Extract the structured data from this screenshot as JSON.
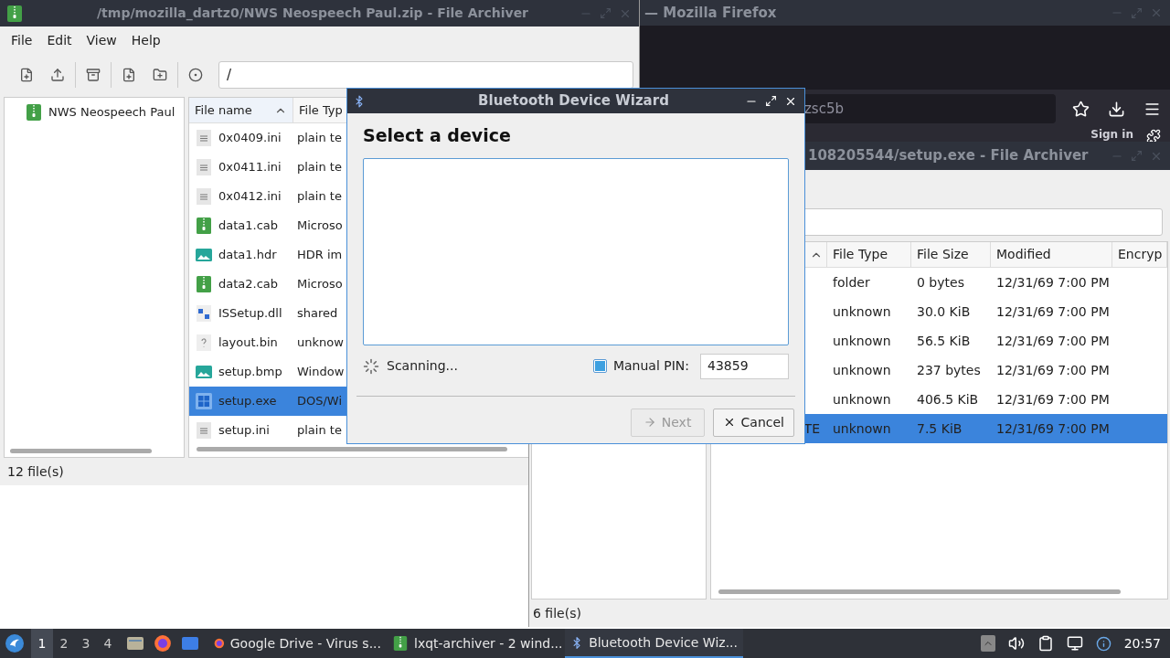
{
  "firefox": {
    "title": "— Mozilla Firefox",
    "url_text": "zsc5b",
    "sign_in": "Sign in"
  },
  "main_archiver": {
    "title": "/tmp/mozilla_dartz0/NWS Neospeech Paul.zip - File Archiver",
    "menu": [
      "File",
      "Edit",
      "View",
      "Help"
    ],
    "path": "/",
    "tree": [
      {
        "label": "NWS Neospeech Paul",
        "selected": false
      }
    ],
    "columns": [
      {
        "label": "File name",
        "sorted": true
      },
      {
        "label": "File Typ",
        "sorted": false
      }
    ],
    "rows": [
      {
        "name": "0x0409.ini",
        "type": "plain te",
        "kind": "text",
        "selected": false
      },
      {
        "name": "0x0411.ini",
        "type": "plain te",
        "kind": "text",
        "selected": false
      },
      {
        "name": "0x0412.ini",
        "type": "plain te",
        "kind": "text",
        "selected": false
      },
      {
        "name": "data1.cab",
        "type": "Microso",
        "kind": "archive",
        "selected": false
      },
      {
        "name": "data1.hdr",
        "type": "HDR im",
        "kind": "image",
        "selected": false
      },
      {
        "name": "data2.cab",
        "type": "Microso",
        "kind": "archive",
        "selected": false
      },
      {
        "name": "ISSetup.dll",
        "type": "shared",
        "kind": "library",
        "selected": false
      },
      {
        "name": "layout.bin",
        "type": "unknow",
        "kind": "unknown",
        "selected": false
      },
      {
        "name": "setup.bmp",
        "type": "Window",
        "kind": "image",
        "selected": false
      },
      {
        "name": "setup.exe",
        "type": "DOS/Wi",
        "kind": "exe",
        "selected": true
      },
      {
        "name": "setup.ini",
        "type": "plain te",
        "kind": "text",
        "selected": false
      }
    ],
    "status": "12 file(s)"
  },
  "second_archiver": {
    "title": "108205544/setup.exe - File Archiver",
    "columns": [
      {
        "label": "File Type"
      },
      {
        "label": "File Size"
      },
      {
        "label": "Modified"
      },
      {
        "label": "Encryp"
      }
    ],
    "rows": [
      {
        "type": "folder",
        "size": "0 bytes",
        "modified": "12/31/69 7:00 PM",
        "selected": false
      },
      {
        "type": "unknown",
        "size": "30.0 KiB",
        "modified": "12/31/69 7:00 PM",
        "selected": false
      },
      {
        "type": "unknown",
        "size": "56.5 KiB",
        "modified": "12/31/69 7:00 PM",
        "selected": false
      },
      {
        "type": "unknown",
        "size": "237 bytes",
        "modified": "12/31/69 7:00 PM",
        "selected": false
      },
      {
        "type": "unknown",
        "size": "406.5 KiB",
        "modified": "12/31/69 7:00 PM",
        "selected": false
      },
      {
        "name": "TE",
        "type": "unknown",
        "size": "7.5 KiB",
        "modified": "12/31/69 7:00 PM",
        "selected": true
      }
    ],
    "status": "6 file(s)"
  },
  "dialog": {
    "title": "Bluetooth Device Wizard",
    "heading": "Select a device",
    "status": "Scanning...",
    "manual_pin": {
      "label": "Manual PIN:",
      "checked": true,
      "value": "43859"
    },
    "buttons": [
      {
        "label": "Next",
        "kind": "next",
        "disabled": true
      },
      {
        "label": "Cancel",
        "kind": "cancel",
        "disabled": false
      }
    ]
  },
  "taskbar": {
    "workspaces": [
      {
        "label": "1",
        "selected": true
      },
      {
        "label": "2",
        "selected": false
      },
      {
        "label": "3",
        "selected": false
      },
      {
        "label": "4",
        "selected": false
      }
    ],
    "tasks": [
      {
        "label": "Google Drive - Virus s...",
        "kind": "browser",
        "selected": false
      },
      {
        "label": "lxqt-archiver - 2 wind...",
        "kind": "archiver",
        "selected": false
      },
      {
        "label": "Bluetooth Device Wiz...",
        "kind": "bluetooth",
        "selected": true
      }
    ],
    "clock": "20:57"
  }
}
